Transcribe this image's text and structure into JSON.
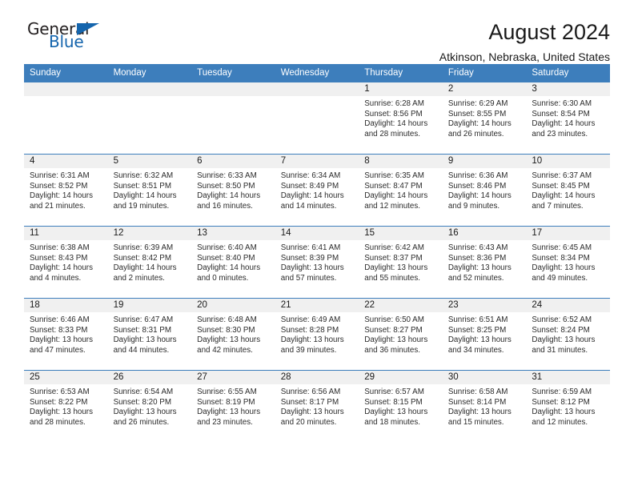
{
  "brand": {
    "name_part1": "General",
    "name_part2": "Blue",
    "accent_color": "#1565ad",
    "triangle_icon": "brand-triangle-icon"
  },
  "header": {
    "title": "August 2024",
    "location": "Atkinson, Nebraska, United States"
  },
  "calendar": {
    "header_bg": "#3d7ebc",
    "daynum_bg": "#f0f0f0",
    "weekday_headers": [
      "Sunday",
      "Monday",
      "Tuesday",
      "Wednesday",
      "Thursday",
      "Friday",
      "Saturday"
    ],
    "weeks": [
      [
        {
          "day": "",
          "sunrise": "",
          "sunset": "",
          "daylight": ""
        },
        {
          "day": "",
          "sunrise": "",
          "sunset": "",
          "daylight": ""
        },
        {
          "day": "",
          "sunrise": "",
          "sunset": "",
          "daylight": ""
        },
        {
          "day": "",
          "sunrise": "",
          "sunset": "",
          "daylight": ""
        },
        {
          "day": "1",
          "sunrise": "Sunrise: 6:28 AM",
          "sunset": "Sunset: 8:56 PM",
          "daylight": "Daylight: 14 hours and 28 minutes."
        },
        {
          "day": "2",
          "sunrise": "Sunrise: 6:29 AM",
          "sunset": "Sunset: 8:55 PM",
          "daylight": "Daylight: 14 hours and 26 minutes."
        },
        {
          "day": "3",
          "sunrise": "Sunrise: 6:30 AM",
          "sunset": "Sunset: 8:54 PM",
          "daylight": "Daylight: 14 hours and 23 minutes."
        }
      ],
      [
        {
          "day": "4",
          "sunrise": "Sunrise: 6:31 AM",
          "sunset": "Sunset: 8:52 PM",
          "daylight": "Daylight: 14 hours and 21 minutes."
        },
        {
          "day": "5",
          "sunrise": "Sunrise: 6:32 AM",
          "sunset": "Sunset: 8:51 PM",
          "daylight": "Daylight: 14 hours and 19 minutes."
        },
        {
          "day": "6",
          "sunrise": "Sunrise: 6:33 AM",
          "sunset": "Sunset: 8:50 PM",
          "daylight": "Daylight: 14 hours and 16 minutes."
        },
        {
          "day": "7",
          "sunrise": "Sunrise: 6:34 AM",
          "sunset": "Sunset: 8:49 PM",
          "daylight": "Daylight: 14 hours and 14 minutes."
        },
        {
          "day": "8",
          "sunrise": "Sunrise: 6:35 AM",
          "sunset": "Sunset: 8:47 PM",
          "daylight": "Daylight: 14 hours and 12 minutes."
        },
        {
          "day": "9",
          "sunrise": "Sunrise: 6:36 AM",
          "sunset": "Sunset: 8:46 PM",
          "daylight": "Daylight: 14 hours and 9 minutes."
        },
        {
          "day": "10",
          "sunrise": "Sunrise: 6:37 AM",
          "sunset": "Sunset: 8:45 PM",
          "daylight": "Daylight: 14 hours and 7 minutes."
        }
      ],
      [
        {
          "day": "11",
          "sunrise": "Sunrise: 6:38 AM",
          "sunset": "Sunset: 8:43 PM",
          "daylight": "Daylight: 14 hours and 4 minutes."
        },
        {
          "day": "12",
          "sunrise": "Sunrise: 6:39 AM",
          "sunset": "Sunset: 8:42 PM",
          "daylight": "Daylight: 14 hours and 2 minutes."
        },
        {
          "day": "13",
          "sunrise": "Sunrise: 6:40 AM",
          "sunset": "Sunset: 8:40 PM",
          "daylight": "Daylight: 14 hours and 0 minutes."
        },
        {
          "day": "14",
          "sunrise": "Sunrise: 6:41 AM",
          "sunset": "Sunset: 8:39 PM",
          "daylight": "Daylight: 13 hours and 57 minutes."
        },
        {
          "day": "15",
          "sunrise": "Sunrise: 6:42 AM",
          "sunset": "Sunset: 8:37 PM",
          "daylight": "Daylight: 13 hours and 55 minutes."
        },
        {
          "day": "16",
          "sunrise": "Sunrise: 6:43 AM",
          "sunset": "Sunset: 8:36 PM",
          "daylight": "Daylight: 13 hours and 52 minutes."
        },
        {
          "day": "17",
          "sunrise": "Sunrise: 6:45 AM",
          "sunset": "Sunset: 8:34 PM",
          "daylight": "Daylight: 13 hours and 49 minutes."
        }
      ],
      [
        {
          "day": "18",
          "sunrise": "Sunrise: 6:46 AM",
          "sunset": "Sunset: 8:33 PM",
          "daylight": "Daylight: 13 hours and 47 minutes."
        },
        {
          "day": "19",
          "sunrise": "Sunrise: 6:47 AM",
          "sunset": "Sunset: 8:31 PM",
          "daylight": "Daylight: 13 hours and 44 minutes."
        },
        {
          "day": "20",
          "sunrise": "Sunrise: 6:48 AM",
          "sunset": "Sunset: 8:30 PM",
          "daylight": "Daylight: 13 hours and 42 minutes."
        },
        {
          "day": "21",
          "sunrise": "Sunrise: 6:49 AM",
          "sunset": "Sunset: 8:28 PM",
          "daylight": "Daylight: 13 hours and 39 minutes."
        },
        {
          "day": "22",
          "sunrise": "Sunrise: 6:50 AM",
          "sunset": "Sunset: 8:27 PM",
          "daylight": "Daylight: 13 hours and 36 minutes."
        },
        {
          "day": "23",
          "sunrise": "Sunrise: 6:51 AM",
          "sunset": "Sunset: 8:25 PM",
          "daylight": "Daylight: 13 hours and 34 minutes."
        },
        {
          "day": "24",
          "sunrise": "Sunrise: 6:52 AM",
          "sunset": "Sunset: 8:24 PM",
          "daylight": "Daylight: 13 hours and 31 minutes."
        }
      ],
      [
        {
          "day": "25",
          "sunrise": "Sunrise: 6:53 AM",
          "sunset": "Sunset: 8:22 PM",
          "daylight": "Daylight: 13 hours and 28 minutes."
        },
        {
          "day": "26",
          "sunrise": "Sunrise: 6:54 AM",
          "sunset": "Sunset: 8:20 PM",
          "daylight": "Daylight: 13 hours and 26 minutes."
        },
        {
          "day": "27",
          "sunrise": "Sunrise: 6:55 AM",
          "sunset": "Sunset: 8:19 PM",
          "daylight": "Daylight: 13 hours and 23 minutes."
        },
        {
          "day": "28",
          "sunrise": "Sunrise: 6:56 AM",
          "sunset": "Sunset: 8:17 PM",
          "daylight": "Daylight: 13 hours and 20 minutes."
        },
        {
          "day": "29",
          "sunrise": "Sunrise: 6:57 AM",
          "sunset": "Sunset: 8:15 PM",
          "daylight": "Daylight: 13 hours and 18 minutes."
        },
        {
          "day": "30",
          "sunrise": "Sunrise: 6:58 AM",
          "sunset": "Sunset: 8:14 PM",
          "daylight": "Daylight: 13 hours and 15 minutes."
        },
        {
          "day": "31",
          "sunrise": "Sunrise: 6:59 AM",
          "sunset": "Sunset: 8:12 PM",
          "daylight": "Daylight: 13 hours and 12 minutes."
        }
      ]
    ]
  }
}
